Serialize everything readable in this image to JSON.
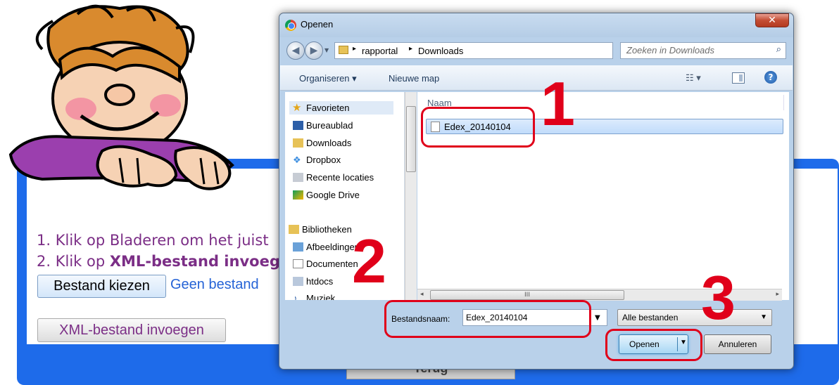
{
  "background": {
    "instructions": {
      "line1": "1. Klik op Bladeren om het juist",
      "line2_prefix": "2. Klik op ",
      "line2_bold": "XML-bestand invoege"
    },
    "choose_file_button": "Bestand kiezen",
    "no_file_text": "Geen bestand",
    "insert_xml_button": "XML-bestand invoegen",
    "bottom_button": "Terug",
    "colors": {
      "blue": "#1e6bea",
      "purple": "#7b2e86"
    }
  },
  "dialog": {
    "title": "Openen",
    "close_glyph": "✕",
    "address": {
      "crumbs": [
        "rapportal",
        "Downloads"
      ]
    },
    "search_placeholder": "Zoeken in Downloads",
    "toolbar": {
      "organize": "Organiseren ▾",
      "new_folder": "Nieuwe map",
      "help": "?"
    },
    "nav": {
      "favorites": "Favorieten",
      "items": [
        "Bureaublad",
        "Downloads",
        "Dropbox",
        "Recente locaties",
        "Google Drive"
      ],
      "libraries": "Bibliotheken",
      "library_items": [
        "Afbeeldingen",
        "Documenten",
        "htdocs",
        "Muziek"
      ]
    },
    "column_header": "Naam",
    "files": [
      "Edex_20140104"
    ],
    "hscroll_grip": "III",
    "filename_label": "Bestandsnaam:",
    "filename_value": "Edex_20140104",
    "filetype": "Alle bestanden",
    "open_button": "Openen",
    "cancel_button": "Annuleren"
  },
  "annotations": {
    "step1": "1",
    "step2": "2",
    "step3": "3",
    "color": "#e0001a"
  }
}
